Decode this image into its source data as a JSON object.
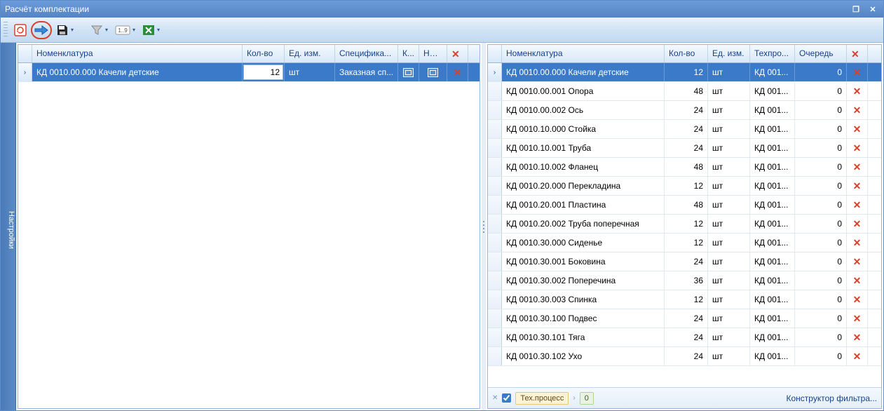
{
  "window": {
    "title": "Расчёт комплектации"
  },
  "sidebar": {
    "label": "Настройки"
  },
  "left": {
    "headers": [
      "Номенклатура",
      "Кол-во",
      "Ед. изм.",
      "Специфика...",
      "К...",
      "Не ..."
    ],
    "rows": [
      {
        "name": "КД 0010.00.000 Качели детские",
        "qty": "12",
        "unit": "шт",
        "spec": "Заказная сп...",
        "selected": true
      }
    ]
  },
  "right": {
    "headers": [
      "Номенклатура",
      "Кол-во",
      "Ед. изм.",
      "Техпро...",
      "Очередь"
    ],
    "rows": [
      {
        "name": "КД 0010.00.000 Качели детские",
        "qty": "12",
        "unit": "шт",
        "tech": "КД 001...",
        "queue": "0",
        "selected": true
      },
      {
        "name": "КД 0010.00.001 Опора",
        "qty": "48",
        "unit": "шт",
        "tech": "КД 001...",
        "queue": "0"
      },
      {
        "name": "КД 0010.00.002 Ось",
        "qty": "24",
        "unit": "шт",
        "tech": "КД 001...",
        "queue": "0"
      },
      {
        "name": "КД 0010.10.000 Стойка",
        "qty": "24",
        "unit": "шт",
        "tech": "КД 001...",
        "queue": "0"
      },
      {
        "name": "КД 0010.10.001 Труба",
        "qty": "24",
        "unit": "шт",
        "tech": "КД 001...",
        "queue": "0"
      },
      {
        "name": "КД 0010.10.002 Фланец",
        "qty": "48",
        "unit": "шт",
        "tech": "КД 001...",
        "queue": "0"
      },
      {
        "name": "КД 0010.20.000 Перекладина",
        "qty": "12",
        "unit": "шт",
        "tech": "КД 001...",
        "queue": "0"
      },
      {
        "name": "КД 0010.20.001 Пластина",
        "qty": "48",
        "unit": "шт",
        "tech": "КД 001...",
        "queue": "0"
      },
      {
        "name": "КД 0010.20.002 Труба поперечная",
        "qty": "12",
        "unit": "шт",
        "tech": "КД 001...",
        "queue": "0"
      },
      {
        "name": "КД 0010.30.000 Сиденье",
        "qty": "12",
        "unit": "шт",
        "tech": "КД 001...",
        "queue": "0"
      },
      {
        "name": "КД 0010.30.001 Боковина",
        "qty": "24",
        "unit": "шт",
        "tech": "КД 001...",
        "queue": "0"
      },
      {
        "name": "КД 0010.30.002 Поперечина",
        "qty": "36",
        "unit": "шт",
        "tech": "КД 001...",
        "queue": "0"
      },
      {
        "name": "КД 0010.30.003 Спинка",
        "qty": "12",
        "unit": "шт",
        "tech": "КД 001...",
        "queue": "0"
      },
      {
        "name": "КД 0010.30.100 Подвес",
        "qty": "24",
        "unit": "шт",
        "tech": "КД 001...",
        "queue": "0"
      },
      {
        "name": "КД 0010.30.101 Тяга",
        "qty": "24",
        "unit": "шт",
        "tech": "КД 001...",
        "queue": "0"
      },
      {
        "name": "КД 0010.30.102 Ухо",
        "qty": "24",
        "unit": "шт",
        "tech": "КД 001...",
        "queue": "0"
      }
    ]
  },
  "footer": {
    "tag1": "Тех.процесс",
    "tag2": "0",
    "editor": "Конструктор фильтра..."
  }
}
